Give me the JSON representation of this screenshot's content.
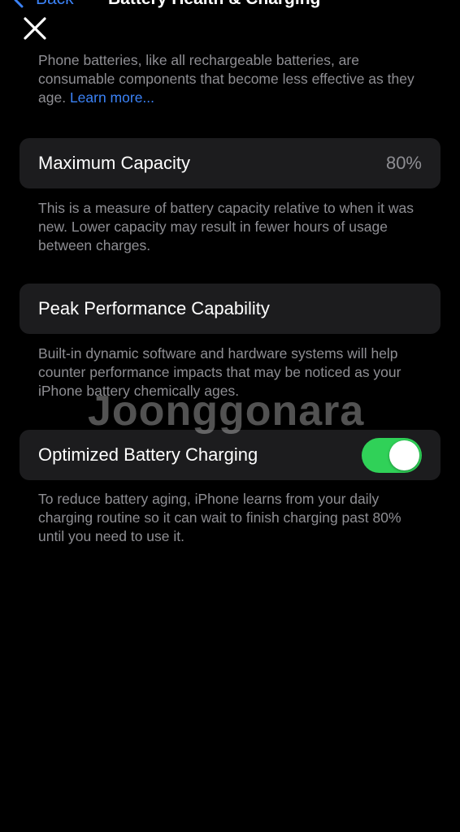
{
  "nav": {
    "back_label": "Back",
    "title": "Battery Health & Charging",
    "back_icon": "chevron-left-icon",
    "close_icon": "close-icon"
  },
  "intro": {
    "text": "Phone batteries, like all rechargeable batteries, are consumable components that become less effective as they age.",
    "link": "Learn more..."
  },
  "max_capacity": {
    "label": "Maximum Capacity",
    "value": "80%",
    "description": "This is a measure of battery capacity relative to when it was new. Lower capacity may result in fewer hours of usage between charges."
  },
  "peak_performance": {
    "label": "Peak Performance Capability",
    "description": "Built-in dynamic software and hardware systems will help counter performance impacts that may be noticed as your iPhone battery chemically ages."
  },
  "optimized_charging": {
    "label": "Optimized Battery Charging",
    "enabled": true,
    "description": "To reduce battery aging, iPhone learns from your daily charging routine so it can wait to finish charging past 80% until you need to use it."
  },
  "watermark": "Joonggonara",
  "colors": {
    "background": "#000000",
    "card": "#1c1c1e",
    "accent_link": "#3b82f6",
    "secondary_text": "#8e8e93",
    "toggle_on": "#30d158"
  }
}
